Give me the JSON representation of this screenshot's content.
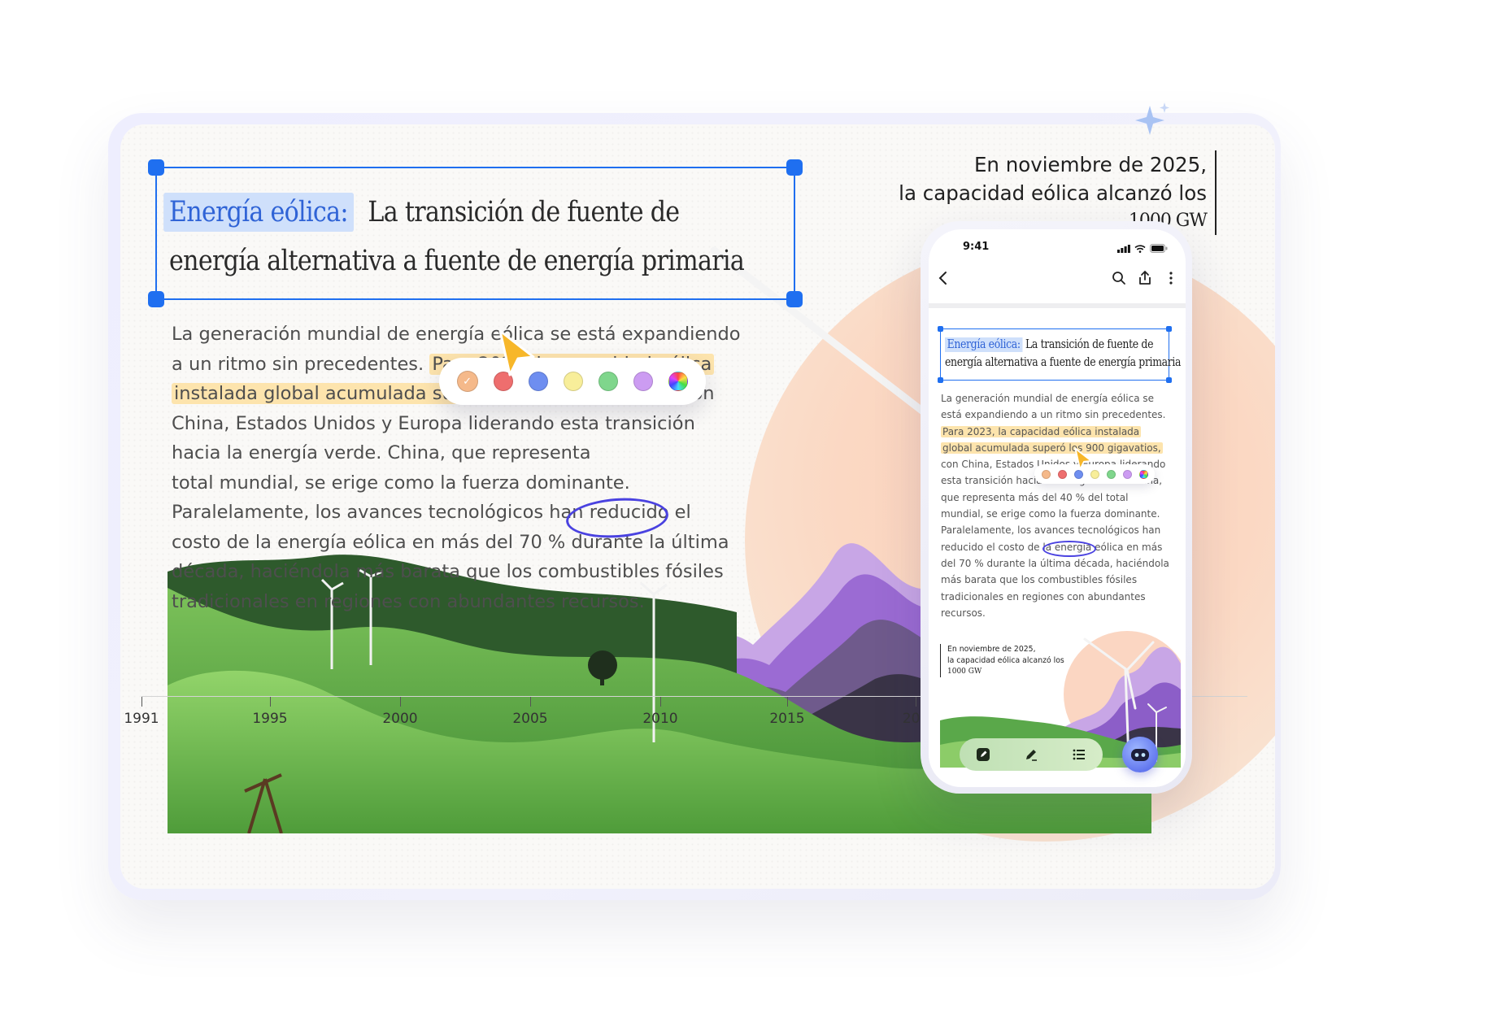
{
  "document": {
    "title_highlight": "Energía eólica:",
    "title_line1_rest": "La transición de fuente de",
    "title_line2": "energía alternativa a fuente de energía primaria",
    "body": {
      "l1": "La generación mundial de energía eólica se está expandiendo",
      "l2_a": "a un ritmo sin precedentes.",
      "l2_b": "Para 2023, la capacidad eólica",
      "l3_a": "instalada global acumulada superó los 900 gigavatios,",
      "l3_b": "con",
      "l4": "China, Estados Unidos y Europa liderando esta transición",
      "l5": "hacia la energía verde. China, que representa",
      "l6": "total mundial, se erige como la fuerza dominante.",
      "l7": "Paralelamente, los avances tecnológicos han reducido el",
      "l8": "costo de la energía eólica en más del 70 % durante la última",
      "l9": "década, haciéndola más barata que los combustibles fósiles",
      "l10": "tradicionales en regiones con abundantes recursos."
    },
    "callout": {
      "line1": "En noviembre de 2025,",
      "line2": "la capacidad eólica alcanzó los",
      "line3": "1000 GW"
    },
    "axis_years": [
      "1991",
      "1995",
      "2000",
      "2005",
      "2010",
      "2015",
      "202"
    ],
    "palette_colors": [
      "#f5b98a",
      "#ee6e6e",
      "#6e8ef0",
      "#f8ee9a",
      "#7fd68c",
      "#cc9cf2",
      "rainbow"
    ]
  },
  "phone": {
    "time": "9:41",
    "nav_icons": [
      "back-icon",
      "search-icon",
      "share-icon",
      "more-icon"
    ],
    "title_highlight": "Energía eólica:",
    "title_line1_rest": "La transición de fuente de",
    "title_line2": "energía alternativa a fuente de energía primaria",
    "body": {
      "l1": "La generación mundial de energía eólica se",
      "l2": "está expandiendo a un ritmo sin precedentes.",
      "l3": "Para 2023, la capacidad eólica instalada",
      "l4": "global acumulada superó los 900 gigavatios,",
      "l5": "con China, Estados Unidos y Europa liderando",
      "l6": "esta transición hacia la energía verde. China,",
      "l7": "que representa más del 40 % del total",
      "l8": "mundial, se erige como la fuerza dominante.",
      "l9": "Paralelamente, los avances tecnológicos han",
      "l10": "reducido el costo de la energía eólica en más",
      "l11": "del 70 % durante la última década, haciéndola",
      "l12": "más barata que los combustibles fósiles",
      "l13": "tradicionales en regiones con abundantes",
      "l14": "recursos."
    },
    "callout": {
      "line1": "En noviembre de 2025,",
      "line2": "la capacidad eólica alcanzó los",
      "line3": "1000 GW"
    },
    "toolbar_icons": [
      "note-icon",
      "highlighter-icon",
      "list-icon"
    ],
    "ai_button_icon": "robot-icon"
  },
  "colors": {
    "selection_blue": "#1f6ff0",
    "highlight_yellow": "#fde4ad",
    "highlight_blue": "#cfe0fb",
    "circle_ink": "#4a42e0",
    "cursor": "#f7b72a"
  }
}
